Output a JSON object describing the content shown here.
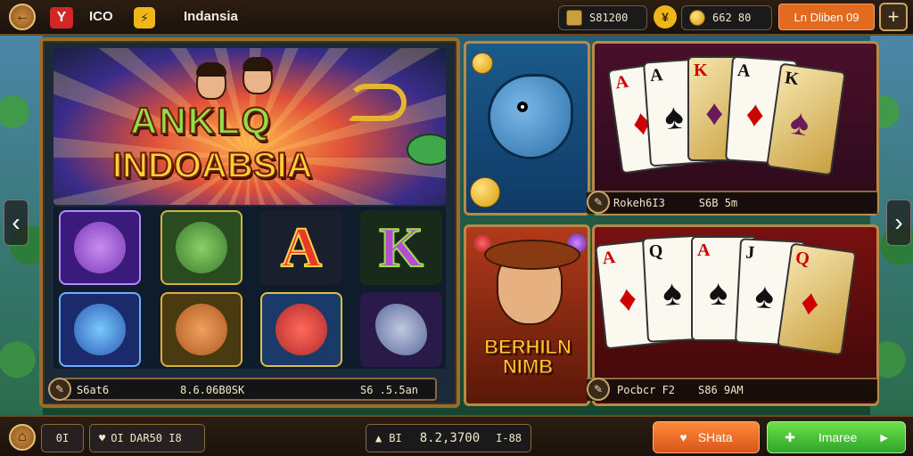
{
  "topbar": {
    "back_label": "←",
    "logo_mark": "Y",
    "ico_label": "ICO",
    "lightning_label": "⚡",
    "brand": "Indansia",
    "balance1": "S81200",
    "coin_label": "¥",
    "balance2": "662 80",
    "promo_label": "Ln Dliben 09",
    "plus_label": "+"
  },
  "main_panel": {
    "title_line1": "ANKLQ",
    "title_line2": "INDOABSIA",
    "reel_letters": [
      "A",
      "K"
    ],
    "bar": {
      "left": "S6at6",
      "middle": "8.6.06B0SK",
      "right": "S6 .5.5an"
    }
  },
  "tiles": {
    "fish_caption": "Rokeh6I3",
    "cards_top_caption": "S6B 5m",
    "hero_title_line1": "BERHILN",
    "hero_title_line2": "NIMB",
    "cards_bottom_caption_left": "Pocbcr F2",
    "cards_bottom_caption_right": "S86 9AM"
  },
  "cards_top": [
    {
      "rank": "A",
      "suit": "♦",
      "color": "red"
    },
    {
      "rank": "A",
      "suit": "♠",
      "color": "black"
    },
    {
      "rank": "K",
      "suit": "♦",
      "color": "red"
    },
    {
      "rank": "A",
      "suit": "♠",
      "color": "black"
    },
    {
      "rank": "K",
      "suit": "♠",
      "color": "black"
    }
  ],
  "cards_bottom": [
    {
      "rank": "A",
      "suit": "♦",
      "color": "red"
    },
    {
      "rank": "Q",
      "suit": "♠",
      "color": "black"
    },
    {
      "rank": "A",
      "suit": "♠",
      "color": "black"
    },
    {
      "rank": "J",
      "suit": "♠",
      "color": "black"
    },
    {
      "rank": "Q",
      "suit": "♦",
      "color": "red"
    }
  ],
  "bottombar": {
    "home_icon": "home-icon",
    "level": "0I",
    "info": "OI DAR50  I8",
    "center_left": "BI",
    "center_value": "8.2,3700",
    "center_right": "I-88",
    "btn_orange": "SHata",
    "btn_green": "Imaree"
  },
  "colors": {
    "frame_gold": "#9a6c2e",
    "accent_orange": "#e26a1e",
    "accent_green": "#2fa52a",
    "coin_gold": "#f0b619"
  }
}
